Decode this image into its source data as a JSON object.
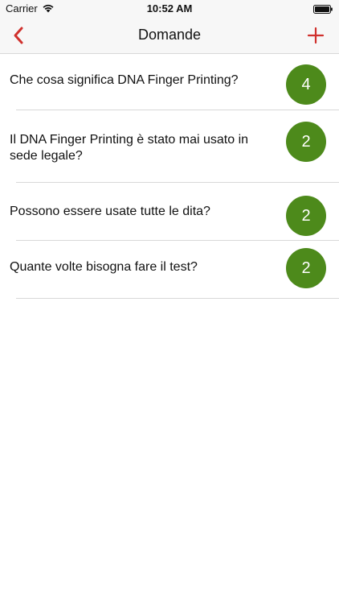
{
  "status_bar": {
    "carrier": "Carrier",
    "time": "10:52 AM",
    "wifi_icon": "wifi-icon",
    "battery_icon": "battery-icon"
  },
  "nav": {
    "title": "Domande",
    "back_icon": "chevron-left-icon",
    "add_icon": "plus-icon",
    "accent_color": "#d0312d"
  },
  "badge_color": "#4d8a1b",
  "questions": [
    {
      "text": "Che cosa significa DNA Finger Printing?",
      "count": "4"
    },
    {
      "text": "Il DNA Finger Printing è stato mai usato in sede legale?",
      "count": "2"
    },
    {
      "text": "Possono essere usate tutte le dita?",
      "count": "2"
    },
    {
      "text": "Quante volte bisogna fare il test?",
      "count": "2"
    }
  ]
}
